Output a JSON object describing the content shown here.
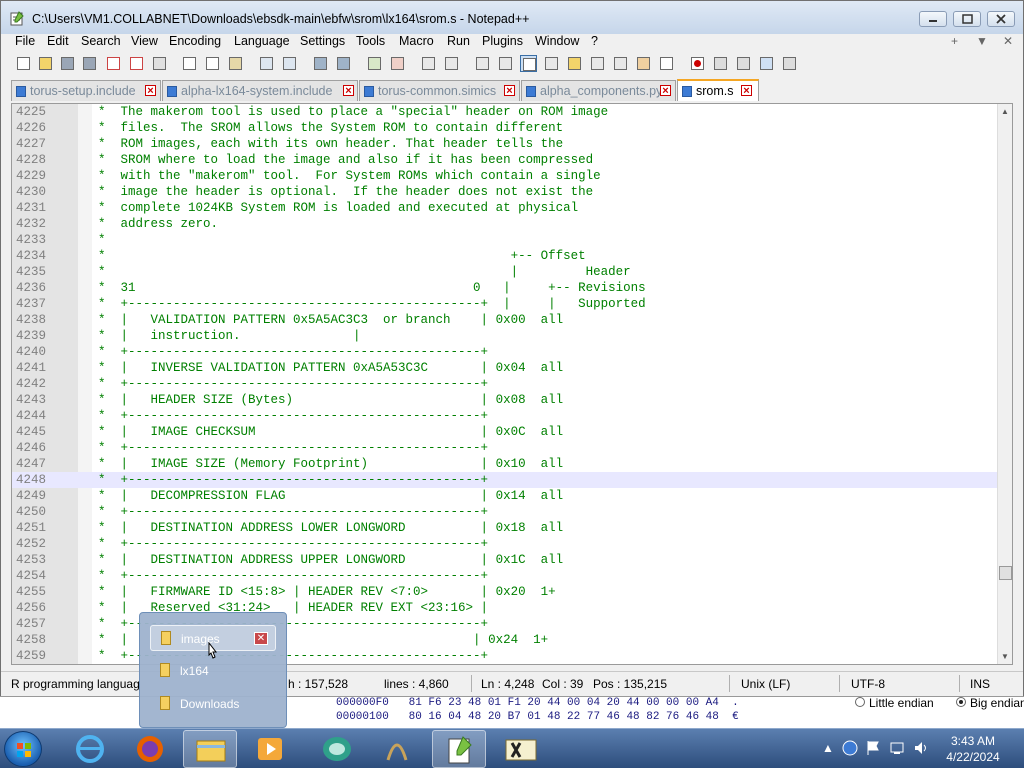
{
  "window": {
    "title": "C:\\Users\\VM1.COLLABNET\\Downloads\\ebsdk-main\\ebfw\\srom\\lx164\\srom.s - Notepad++"
  },
  "menu": {
    "items": [
      "File",
      "Edit",
      "Search",
      "View",
      "Encoding",
      "Language",
      "Settings",
      "Tools",
      "Macro",
      "Run",
      "Plugins",
      "Window",
      "?"
    ],
    "right": [
      "+",
      "▼",
      "✕"
    ]
  },
  "tabs": [
    {
      "label": "torus-setup.include"
    },
    {
      "label": "alpha-lx164-system.include"
    },
    {
      "label": "torus-common.simics"
    },
    {
      "label": "alpha_components.py"
    },
    {
      "label": "srom.s"
    }
  ],
  "editor": {
    "current_line": "4248",
    "lines": [
      {
        "n": "4225",
        "t": "*  The makerom tool is used to place a \"special\" header on ROM image"
      },
      {
        "n": "4226",
        "t": "*  files.  The SROM allows the System ROM to contain different"
      },
      {
        "n": "4227",
        "t": "*  ROM images, each with its own header. That header tells the"
      },
      {
        "n": "4228",
        "t": "*  SROM where to load the image and also if it has been compressed"
      },
      {
        "n": "4229",
        "t": "*  with the \"makerom\" tool.  For System ROMs which contain a single"
      },
      {
        "n": "4230",
        "t": "*  image the header is optional.  If the header does not exist the"
      },
      {
        "n": "4231",
        "t": "*  complete 1024KB System ROM is loaded and executed at physical"
      },
      {
        "n": "4232",
        "t": "*  address zero."
      },
      {
        "n": "4233",
        "t": "*"
      },
      {
        "n": "4234",
        "t": "*                                                      +-- Offset"
      },
      {
        "n": "4235",
        "t": "*                                                      |         Header"
      },
      {
        "n": "4236",
        "t": "*  31                                             0   |     +-- Revisions"
      },
      {
        "n": "4237",
        "t": "*  +-----------------------------------------------+  |     |   Supported"
      },
      {
        "n": "4238",
        "t": "*  |   VALIDATION PATTERN 0x5A5AC3C3  or branch    | 0x00  all"
      },
      {
        "n": "4239",
        "t": "*  |   instruction.               |"
      },
      {
        "n": "4240",
        "t": "*  +-----------------------------------------------+"
      },
      {
        "n": "4241",
        "t": "*  |   INVERSE VALIDATION PATTERN 0xA5A53C3C       | 0x04  all"
      },
      {
        "n": "4242",
        "t": "*  +-----------------------------------------------+"
      },
      {
        "n": "4243",
        "t": "*  |   HEADER SIZE (Bytes)                         | 0x08  all"
      },
      {
        "n": "4244",
        "t": "*  +-----------------------------------------------+"
      },
      {
        "n": "4245",
        "t": "*  |   IMAGE CHECKSUM                              | 0x0C  all"
      },
      {
        "n": "4246",
        "t": "*  +-----------------------------------------------+"
      },
      {
        "n": "4247",
        "t": "*  |   IMAGE SIZE (Memory Footprint)               | 0x10  all"
      },
      {
        "n": "4248",
        "t": "*  +-----------------------------------------------+"
      },
      {
        "n": "4249",
        "t": "*  |   DECOMPRESSION FLAG                          | 0x14  all"
      },
      {
        "n": "4250",
        "t": "*  +-----------------------------------------------+"
      },
      {
        "n": "4251",
        "t": "*  |   DESTINATION ADDRESS LOWER LONGWORD          | 0x18  all"
      },
      {
        "n": "4252",
        "t": "*  +-----------------------------------------------+"
      },
      {
        "n": "4253",
        "t": "*  |   DESTINATION ADDRESS UPPER LONGWORD          | 0x1C  all"
      },
      {
        "n": "4254",
        "t": "*  +-----------------------------------------------+"
      },
      {
        "n": "4255",
        "t": "*  |   FIRMWARE ID <15:8> | HEADER REV <7:0>       | 0x20  1+"
      },
      {
        "n": "4256",
        "t": "*  |   Reserved <31:24>   | HEADER REV EXT <23:16> |"
      },
      {
        "n": "4257",
        "t": "*  +-----------------------------------------------+"
      },
      {
        "n": "4258",
        "t": "*  |                                              | 0x24  1+"
      },
      {
        "n": "4259",
        "t": "*  +-----------------------------------------------+"
      }
    ]
  },
  "status": {
    "type": "R programming languag",
    "length": "h : 157,528",
    "lines": "lines : 4,860",
    "ln": "Ln : 4,248",
    "col": "Col : 39",
    "pos": "Pos : 135,215",
    "eol": "Unix (LF)",
    "encoding": "UTF-8",
    "mode": "INS"
  },
  "background_app": {
    "hex_rows": [
      "000000F0   81 F6 23 48 01 F1 20 44 00 04 20 44 00 00 00 A4  .",
      "00000100   80 16 04 48 20 B7 01 48 22 77 46 48 82 76 46 48  €"
    ],
    "little_endian": "Little endian",
    "big_endian": "Big endian"
  },
  "jumplist": {
    "items": [
      {
        "label": "images"
      },
      {
        "label": "lx164"
      },
      {
        "label": "Downloads"
      }
    ]
  },
  "taskbar": {
    "time": "3:43 AM",
    "date": "4/22/2024"
  },
  "colors": {
    "comment_green": "#008000",
    "line_number_gray": "#808080",
    "current_line_bg": "#e8e8ff",
    "active_tab_accent": "#f5a623",
    "taskbar_blue": "#2d4d7c"
  }
}
